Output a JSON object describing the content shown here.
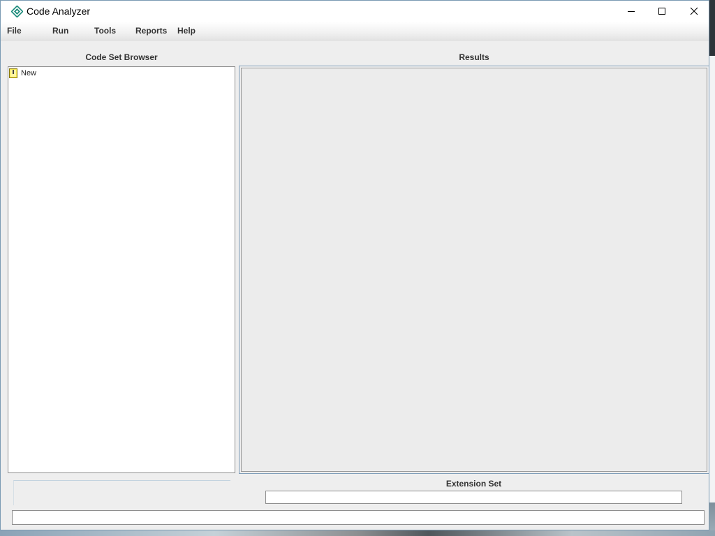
{
  "window": {
    "title": "Code Analyzer"
  },
  "menu": {
    "items": [
      "File",
      "Run",
      "Tools",
      "Reports",
      "Help"
    ]
  },
  "browser": {
    "title": "Code Set Browser",
    "nodes": [
      {
        "label": "New",
        "icon": "code-set-icon"
      }
    ]
  },
  "results": {
    "title": "Results"
  },
  "extension": {
    "title": "Extension Set",
    "value": ""
  },
  "status": {
    "value": ""
  },
  "colors": {
    "accent": "#1a8a7a",
    "border": "#7f9db9",
    "panel": "#eeeeee"
  }
}
